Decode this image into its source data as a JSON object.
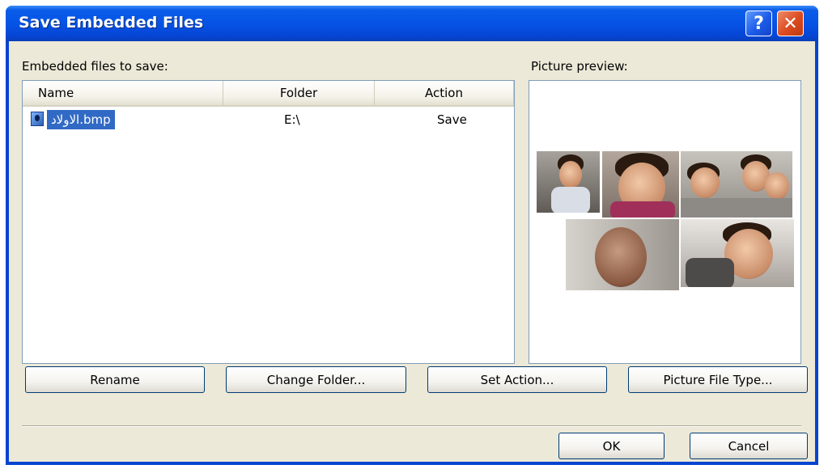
{
  "window": {
    "title": "Save Embedded Files",
    "help_glyph": "?",
    "close_glyph": "✕"
  },
  "left_label": "Embedded files to save:",
  "right_label": "Picture preview:",
  "list": {
    "columns": [
      "Name",
      "Folder",
      "Action"
    ],
    "rows": [
      {
        "icon": "bitmap-file-icon",
        "name": "الاولاد.bmp",
        "folder": "E:\\",
        "action": "Save",
        "selected": true
      }
    ]
  },
  "buttons": {
    "rename": "Rename",
    "change_folder": "Change Folder...",
    "set_action": "Set Action...",
    "picture_file_type": "Picture File Type...",
    "ok": "OK",
    "cancel": "Cancel"
  },
  "colors": {
    "title_bar": "#0653e6",
    "dialog_face": "#ece9d8",
    "selection": "#316ac5",
    "close_button": "#db4a1f"
  }
}
